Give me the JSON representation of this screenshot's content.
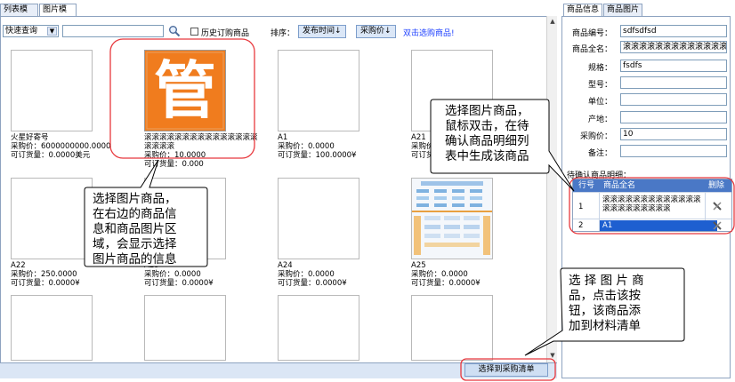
{
  "tabs": {
    "list_mode": "列表模式",
    "image_mode": "图片模式"
  },
  "toolbar": {
    "quick_query": "快速查询",
    "history_checkbox_label": "历史订购商品",
    "sort_label": "排序：",
    "sort_by_time": "发布时间↓",
    "sort_by_price": "采购价↓",
    "double_click_hint": "双击选购商品!"
  },
  "products": [
    {
      "name": "火星好寄号",
      "price": "采购价：6000000000.0000",
      "stock": "可订货量：0.0000美元"
    },
    {
      "name": "滚滚滚滚滚滚滚滚滚滚滚滚滚滚滚",
      "name2": "滚滚滚滚",
      "price": "采购价：10.0000",
      "stock": "可订货量：0.000",
      "logo_char": "管"
    },
    {
      "name": "A1",
      "price": "采购价：0.0000",
      "stock": "可订货量：100.0000¥"
    },
    {
      "name": "A21",
      "price": "采购价：0",
      "stock": "可订货量：0"
    },
    {
      "name": "A22",
      "price": "采购价：250.0000",
      "stock": "可订货量：0.0000¥"
    },
    {
      "name": "A23",
      "price": "采购价：0.0000",
      "stock": "可订货量：0.0000¥"
    },
    {
      "name": "A24",
      "price": "采购价：0.0000",
      "stock": "可订货量：0.0000¥"
    },
    {
      "name": "A25",
      "price": "采购价：0.0000",
      "stock": "可订货量：0.0000¥"
    }
  ],
  "confirm_button": "选择到采购清单",
  "right_tabs": {
    "info": "商品信息",
    "image": "商品图片"
  },
  "form": {
    "code_label": "商品编号：",
    "code_value": "sdfsdfsd",
    "fullname_label": "商品全名：",
    "fullname_value": "滚滚滚滚滚滚滚滚滚滚滚滚滚",
    "spec_label": "规格：",
    "spec_value": "fsdfs",
    "model_label": "型号：",
    "model_value": "",
    "unit_label": "单位：",
    "unit_value": "",
    "origin_label": "产地：",
    "origin_value": "",
    "price_label": "采购价：",
    "price_value": "10",
    "remark_label": "备注：",
    "remark_value": ""
  },
  "pending": {
    "title": "待确认商品明细：",
    "col_no": "行号",
    "col_name": "商品全名",
    "col_delete": "删除",
    "rows": [
      {
        "no": "1",
        "name_line1": "滚滚滚滚滚滚滚滚滚滚滚滚滚",
        "name_line2": "滚滚滚滚滚滚滚滚滚"
      },
      {
        "no": "2",
        "name_line1": "A1"
      }
    ]
  },
  "callouts": {
    "top_right": [
      "选择图片商品，",
      "鼠标双击，在待",
      "确认商品明细列",
      "表中生成该商品"
    ],
    "middle": [
      "选择图片商品，",
      "在右边的商品信",
      "息和商品图片区",
      "域，会显示选择",
      "图片商品的信息"
    ],
    "bottom_right": [
      "选 择 图 片 商",
      "品，点击该按",
      "钮，该商品添",
      "加到材料清单"
    ]
  },
  "colors": {
    "accent": "#e8383d",
    "link": "#1e40ff",
    "logo_bg": "#f07c1e",
    "grid_head": "#4a78c6"
  }
}
